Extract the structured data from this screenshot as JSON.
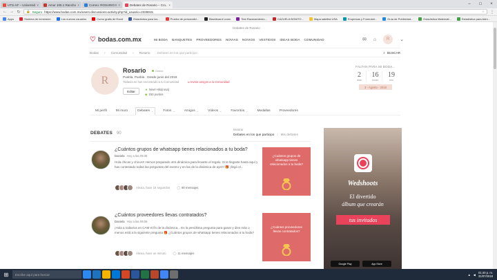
{
  "browser": {
    "tabs": [
      {
        "label": "UTS-AF – Universidad de...",
        "color": "#e84d3d"
      },
      {
        "label": "Amor 105.1 Rancho...",
        "color": "#c0392b"
      },
      {
        "label": "Correo: ROSARIO MART...",
        "color": "#2b7cd3"
      },
      {
        "label": "Debates de Rosario – Cro...",
        "color": "#e8435a",
        "active": true
      }
    ],
    "url_secure_label": "Seguro",
    "url": "https://www.bodas.com.mx/users-discussions-activity.php?id_usuario=2328915",
    "bookmarks": [
      "Apps",
      "Sistema de inmersión",
      "Los nuevos usuarios",
      "Curso gratis de Excel",
      "Estadística para los...",
      "Prueba de personalid...",
      "Blackboard Learn",
      "Test Razonamiento...",
      "CAZUELA BONITO...",
      "Mapa satelital USA",
      "Empresas y Formulari...",
      "Guía de Publicidad...",
      "Estadística Matemati...",
      "Estadística para Adm..."
    ]
  },
  "site": {
    "topline": "Debates de Rosario",
    "logo": "bodas.com.mx",
    "nav": [
      "MI BODA",
      "BANQUETES",
      "PROVEEDORES",
      "NOVIAS",
      "NOVIOS",
      "VESTIDOS",
      "IDEAS BODA",
      "COMUNIDAD"
    ],
    "user_initial": "R",
    "breadcrumbs": [
      "Bodas",
      "Comunidad",
      "Rosario"
    ],
    "search_placeholder": "Debates en los que participo",
    "search_label": "BUSCAR"
  },
  "profile": {
    "initial": "R",
    "name": "Rosario",
    "status": "Online",
    "location": "Puebla, Puebla · Desde junio del 2018",
    "wedding_line": "Todavía no has encontrado a tu Comunidad",
    "invite": "Invitar amigos a la Comunidad",
    "edit_label": "Editar",
    "level": "Nivel Hilo(rosa)",
    "points": "153 puntos",
    "countdown_title": "FALTAN PARA MI BODA...",
    "countdown": [
      {
        "n": "2",
        "u": "días"
      },
      {
        "n": "16",
        "u": "horas"
      },
      {
        "n": "19",
        "u": "min"
      }
    ],
    "date": "3 - Agosto - 2018"
  },
  "tabs": [
    {
      "label": "Mi perfil"
    },
    {
      "label": "Mi muro"
    },
    {
      "label": "Debates",
      "active": true
    },
    {
      "label": "Fotos"
    },
    {
      "label": "Amigos"
    },
    {
      "label": "Vídeos"
    },
    {
      "label": "Favoritos"
    },
    {
      "label": "Medallas"
    },
    {
      "label": "Proveedores"
    }
  ],
  "debates": {
    "title": "DEBATES",
    "count": "90",
    "filter_label": "Mostrar",
    "filter_on": "Debates en los que participo",
    "filter_off": "Mis debates"
  },
  "posts": [
    {
      "title": "¿Cuántos grupos de whatsapp tienes relacionados a tu boda?",
      "author": "Daniela",
      "time": "Hoy a las 09:35",
      "body": "Hola chicas y chicos!! Hemos preparado otra dinámica para llevarte el regalo. Si te llegaste hasta aquí y has contestado todas las preguntas del evento y en las de la dinámica de ayer!! 🎁 ¡llegó el...",
      "last_reply": "Alexia, hace 16 segundos",
      "replies": "90 mensajes",
      "thumb_text": "¿Cuántos grupos de whatsapp tienes relacionados a tu boda?"
    },
    {
      "title": "¿Cuántos proveedores llevas contratados?",
      "author": "Daniela",
      "time": "Hoy a las 09:08",
      "body": "¡Hola a todas/os en CAM el fin de la dinámica... Es la penúltima pregunta para ganar y dies más o menos está a la siguiente pregunta 🎁 ¿Cuántos grupos de whatsapp tienes relacionados a tu boda?",
      "last_reply": "Alexia, hace un minuto",
      "replies": "11 mensajes",
      "thumb_text": "¿Cuántos proveedores llevas contratados?"
    }
  ],
  "ad": {
    "brand": "Wedshoots",
    "line1": "El divertido",
    "line2": "álbum que crearán",
    "tag": "tus invitados",
    "store1": "Google Play",
    "store2": "App Store"
  },
  "taskbar": {
    "search_placeholder": "Escribe aquí para buscar",
    "time": "01:40 p. m.",
    "date": "31/07/2018"
  }
}
